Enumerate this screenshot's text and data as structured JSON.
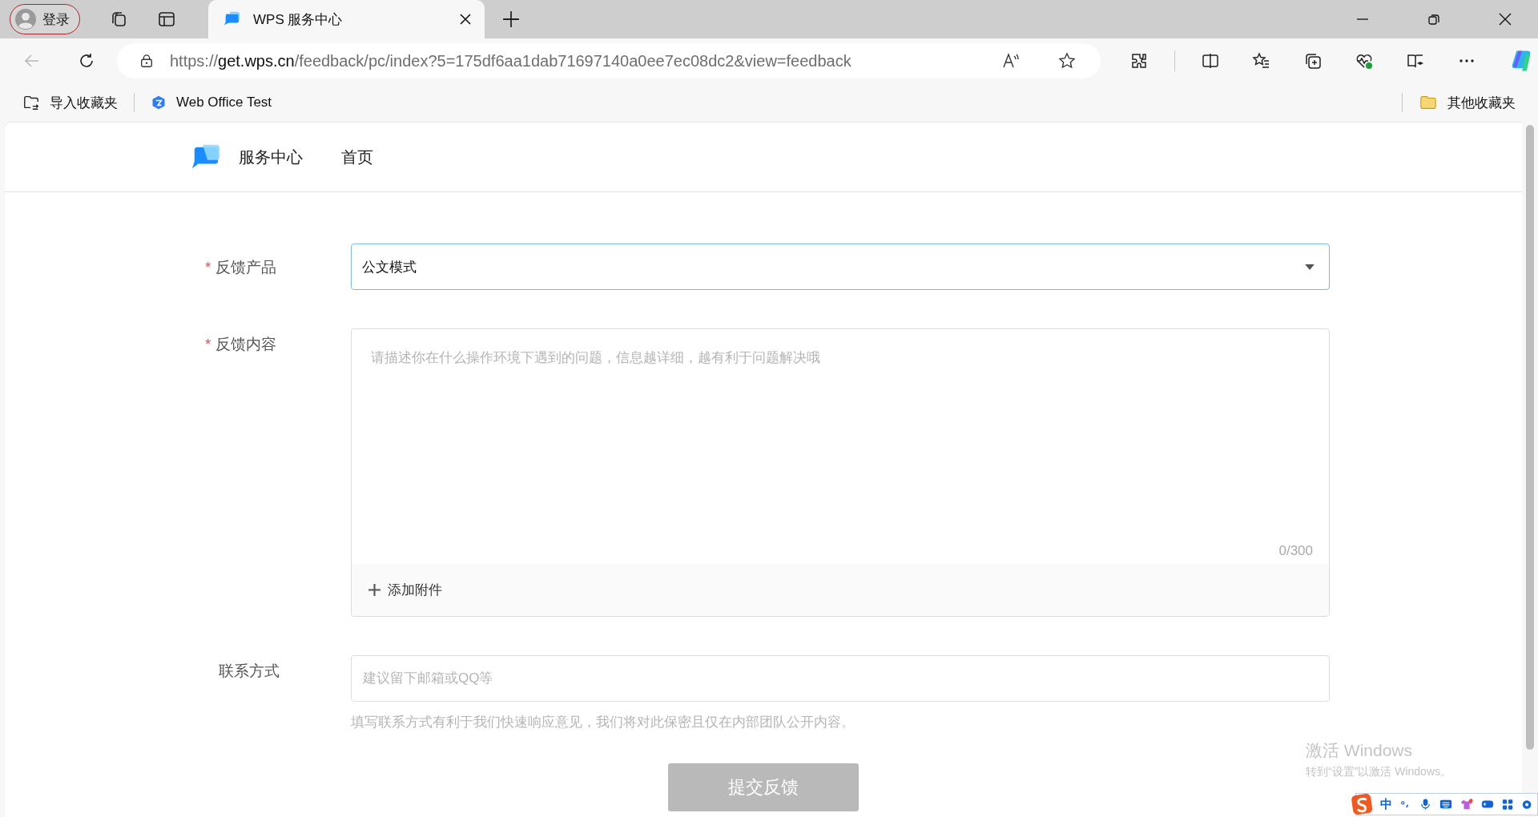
{
  "browser": {
    "profile": {
      "label": "登录"
    },
    "tabs": [
      {
        "title": "WPS 服务中心",
        "selected": true
      }
    ],
    "url": {
      "scheme": "https://",
      "host": "get.wps.cn",
      "path": "/feedback/pc/index?5=175df6aa1dab71697140a0ee7ec08dc2&view=feedback"
    },
    "bookmarks": [
      {
        "label": "导入收藏夹",
        "kind": "import"
      },
      {
        "label": "Web Office Test",
        "kind": "site"
      }
    ],
    "other_bookmarks": "其他收藏夹"
  },
  "site": {
    "brand": "服务中心",
    "nav": [
      "首页"
    ]
  },
  "form": {
    "required_mark": "*",
    "fields": [
      {
        "kind": "select",
        "label": "反馈产品",
        "required": true,
        "value": "公文模式",
        "focused": true
      },
      {
        "kind": "textarea",
        "label": "反馈内容",
        "required": true,
        "placeholder": "请描述你在什么操作环境下遇到的问题，信息越详细，越有利于问题解决哦",
        "counter": "0/300",
        "attach": "添加附件"
      },
      {
        "kind": "input",
        "label": "联系方式",
        "required": false,
        "placeholder": "建议留下邮箱或QQ等",
        "hint": "填写联系方式有利于我们快速响应意见，我们将对此保密且仅在内部团队公开内容。"
      }
    ],
    "submit": {
      "label": "提交反馈",
      "disabled": true
    }
  },
  "activation": {
    "title": "激活 Windows",
    "subtitle": "转到“设置”以激活 Windows。"
  },
  "ime": {
    "mode": "中"
  }
}
